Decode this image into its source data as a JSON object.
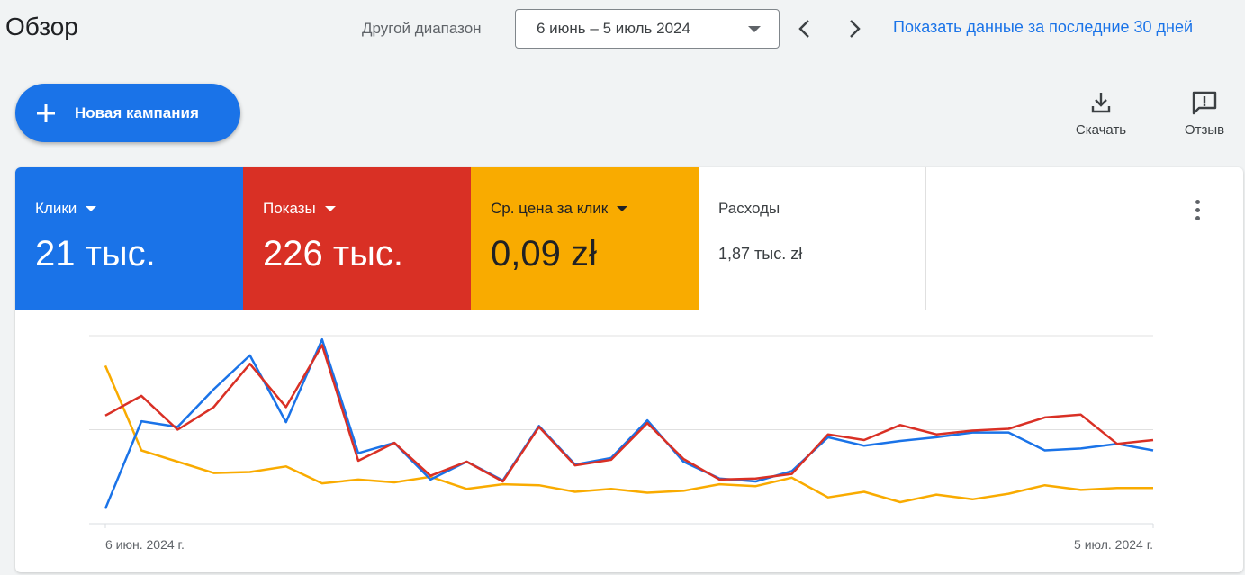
{
  "header": {
    "title": "Обзор",
    "range_label": "Другой диапазон",
    "range_value": "6 июнь – 5 июль 2024",
    "last30_link": "Показать данные за последние 30 дней"
  },
  "toolbar": {
    "new_campaign_label": "Новая кампания",
    "download_label": "Скачать",
    "feedback_label": "Отзыв"
  },
  "metrics": {
    "clicks": {
      "label": "Клики",
      "value": "21 тыс.",
      "color": "#1a73e8"
    },
    "impressions": {
      "label": "Показы",
      "value": "226 тыс.",
      "color": "#d93025"
    },
    "cpc": {
      "label": "Ср. цена за клик",
      "value": "0,09 zł",
      "color": "#f9ab00"
    },
    "cost": {
      "label": "Расходы",
      "value": "1,87 тыс. zł"
    }
  },
  "chart_data": {
    "type": "line",
    "x": [
      "2024-06-06",
      "2024-06-07",
      "2024-06-08",
      "2024-06-09",
      "2024-06-10",
      "2024-06-11",
      "2024-06-12",
      "2024-06-13",
      "2024-06-14",
      "2024-06-15",
      "2024-06-16",
      "2024-06-17",
      "2024-06-18",
      "2024-06-19",
      "2024-06-20",
      "2024-06-21",
      "2024-06-22",
      "2024-06-23",
      "2024-06-24",
      "2024-06-25",
      "2024-06-26",
      "2024-06-27",
      "2024-06-28",
      "2024-06-29",
      "2024-06-30",
      "2024-07-01",
      "2024-07-02",
      "2024-07-03",
      "2024-07-04",
      "2024-07-05"
    ],
    "x_tick_labels": [
      "6 июн. 2024 г.",
      "5 июл. 2024 г."
    ],
    "grid": true,
    "series": [
      {
        "color": "#1a73e8",
        "values": [
          0.16,
          1.09,
          1.03,
          1.43,
          1.79,
          1.08,
          1.96,
          0.75,
          0.86,
          0.47,
          0.66,
          0.46,
          1.04,
          0.63,
          0.7,
          1.1,
          0.66,
          0.48,
          0.45,
          0.56,
          0.92,
          0.83,
          0.88,
          0.92,
          0.97,
          0.97,
          0.78,
          0.8,
          0.85,
          0.78
        ]
      },
      {
        "color": "#d93025",
        "values": [
          1.15,
          1.36,
          1.0,
          1.24,
          1.7,
          1.24,
          1.9,
          0.67,
          0.86,
          0.51,
          0.66,
          0.45,
          1.03,
          0.62,
          0.68,
          1.07,
          0.69,
          0.47,
          0.48,
          0.53,
          0.95,
          0.89,
          1.05,
          0.95,
          0.99,
          1.01,
          1.13,
          1.16,
          0.85,
          0.89
        ]
      },
      {
        "color": "#f9ab00",
        "values": [
          1.68,
          0.78,
          0.66,
          0.54,
          0.55,
          0.61,
          0.43,
          0.47,
          0.44,
          0.5,
          0.37,
          0.42,
          0.41,
          0.34,
          0.37,
          0.33,
          0.35,
          0.42,
          0.4,
          0.49,
          0.28,
          0.34,
          0.23,
          0.31,
          0.26,
          0.32,
          0.41,
          0.36,
          0.38,
          0.38
        ]
      }
    ],
    "ylim": [
      0,
      2
    ]
  }
}
